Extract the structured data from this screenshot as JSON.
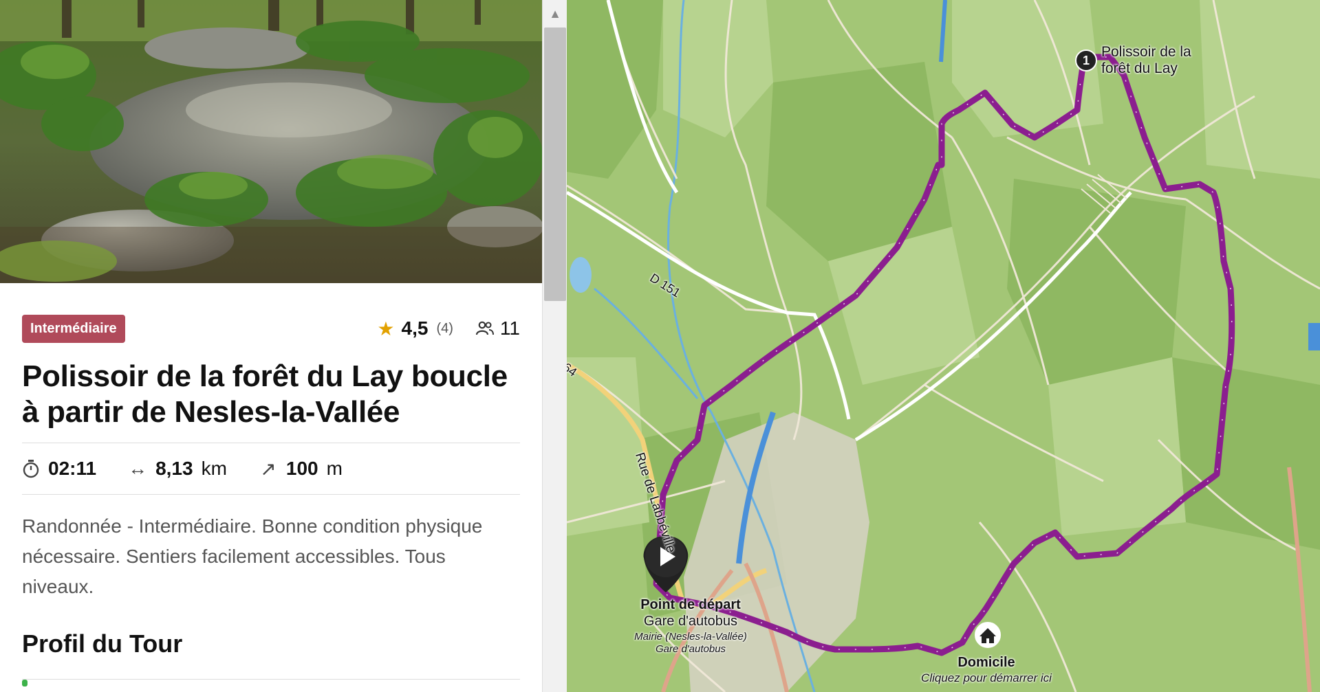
{
  "tour": {
    "difficulty": "Intermédiaire",
    "rating": "4,5",
    "rating_count": "(4)",
    "participants": "11",
    "title": "Polissoir de la forêt du Lay boucle à partir de Nesles-la-Vallée",
    "duration": "02:11",
    "distance_value": "8,13",
    "distance_unit": "km",
    "elevation_value": "100",
    "elevation_unit": "m",
    "description": "Randonnée - Intermédiaire. Bonne condition physique nécessaire. Sentiers facilement accessibles. Tous niveaux.",
    "profile_heading": "Profil du Tour"
  },
  "icons": {
    "difficulty_color": "#b04a5a",
    "star": "star-icon",
    "users": "users-icon",
    "duration": "stopwatch-icon",
    "distance": "arrows-horizontal-icon",
    "elevation": "arrow-up-right-icon",
    "start": "play-icon",
    "home": "house-icon"
  },
  "map": {
    "waypoint_number": "1",
    "waypoint_label_line1": "Polissoir de la",
    "waypoint_label_line2": "forêt du Lay",
    "start_label": "Point de départ",
    "start_sub": "Gare d'autobus",
    "bus_stop_line1": "Mairie (Nesles-la-Vallée)",
    "bus_stop_line2": "Gare d'autobus",
    "home_label": "Domicile",
    "home_sub": "Cliquez pour démarrer ici",
    "road_d151": "D 151",
    "road_labbeville": "Rue de Labbéville",
    "road_64": "64",
    "route_color": "#8b1e8f"
  }
}
